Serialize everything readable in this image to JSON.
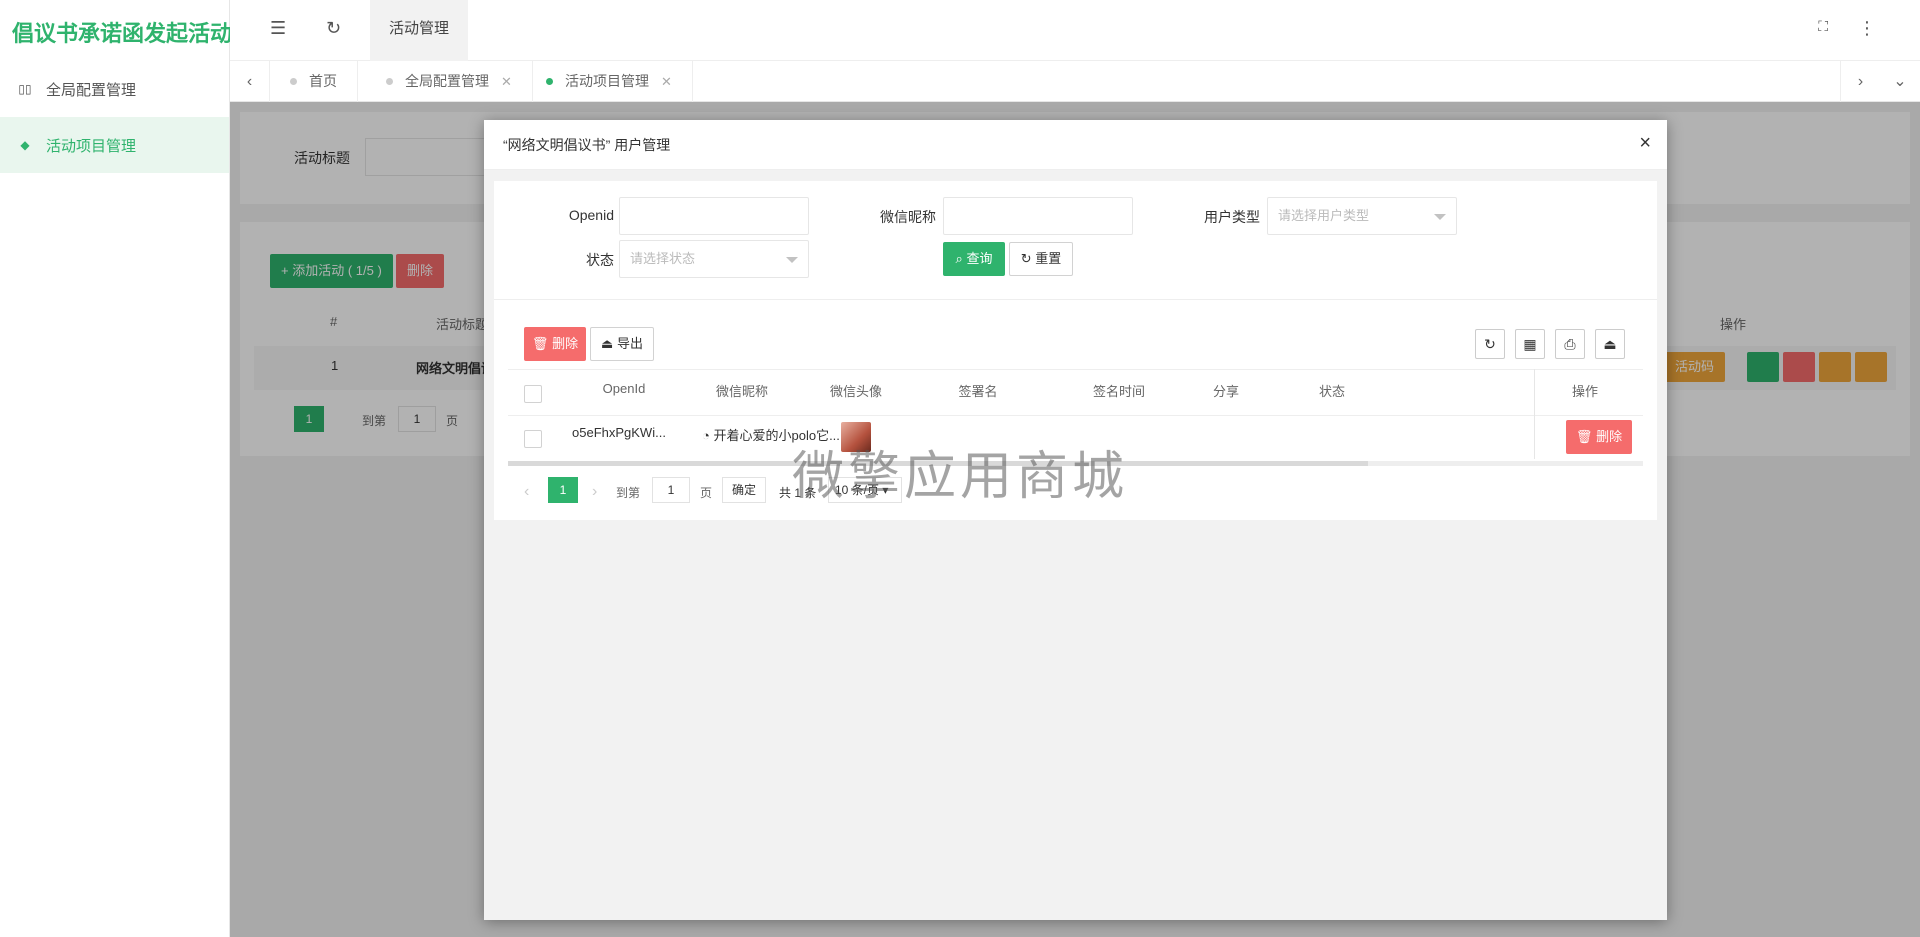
{
  "app": {
    "title": "倡议书承诺函发起活动"
  },
  "sidebar": {
    "items": [
      {
        "icon": "grid-icon",
        "label": "全局配置管理"
      },
      {
        "icon": "layers-icon",
        "label": "活动项目管理",
        "active": true
      }
    ]
  },
  "topbar": {
    "page_title": "活动管理"
  },
  "tabs": [
    {
      "label": "首页"
    },
    {
      "label": "全局配置管理"
    },
    {
      "label": "活动项目管理",
      "active": true
    }
  ],
  "background_page": {
    "search_label": "活动标题",
    "add_button": "+ 添加活动 ( 1/5 )",
    "delete_button": "删除",
    "columns": [
      "#",
      "活动标题",
      "操作"
    ],
    "row": {
      "index": "1",
      "title": "网络文明倡议书"
    },
    "row_action": "活动码",
    "pagination": {
      "current": "1",
      "goto": "到第",
      "page_value": "1",
      "page": "页"
    }
  },
  "modal": {
    "title": "“网络文明倡议书” 用户管理",
    "close": "×",
    "filters": {
      "openid_label": "Openid",
      "nickname_label": "微信昵称",
      "user_type_label": "用户类型",
      "user_type_placeholder": "请选择用户类型",
      "status_label": "状态",
      "status_placeholder": "请选择状态",
      "query_button": "查询",
      "reset_button": "重置"
    },
    "toolbar": {
      "delete_button": "删除",
      "export_button": "导出"
    },
    "table": {
      "columns": [
        "OpenId",
        "微信昵称",
        "微信头像",
        "签署名",
        "签名时间",
        "分享",
        "状态",
        "操作"
      ],
      "rows": [
        {
          "openid": "o5eFhxPgKWi...",
          "nickname": "开着心爱的小polo它...",
          "signer": "",
          "sign_time": "",
          "share": "",
          "status": "",
          "action": "删除"
        }
      ]
    },
    "pagination": {
      "current": "1",
      "goto": "到第",
      "page_value": "1",
      "page": "页",
      "confirm": "确定",
      "total": "共 1 条",
      "page_size": "10 条/页"
    }
  },
  "watermark": "微擎应用商城",
  "colors": {
    "brand": "#2fb36d",
    "danger": "#f56c6c",
    "warning": "#f0a73c"
  }
}
